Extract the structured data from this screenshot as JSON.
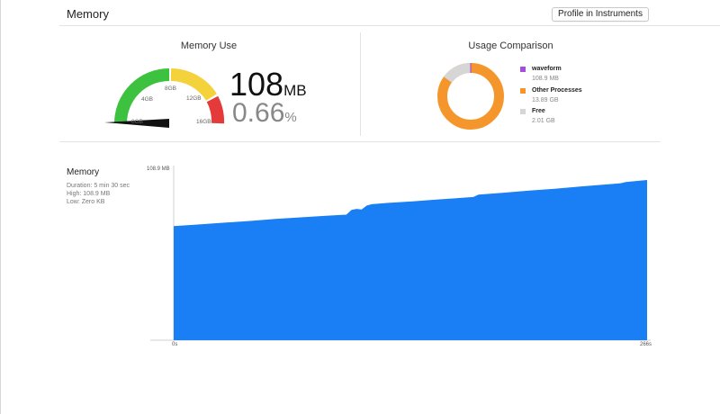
{
  "header": {
    "title": "Memory",
    "profile_button": "Profile in Instruments"
  },
  "memory_use": {
    "title": "Memory Use",
    "value": "108",
    "unit": "MB",
    "percent": "0.66",
    "percent_symbol": "%",
    "gauge_labels": [
      "0GB",
      "4GB",
      "8GB",
      "12GB",
      "16GB"
    ],
    "gauge_fraction": 0.0066,
    "colors": {
      "green": "#3cc23f",
      "yellow": "#f4d23b",
      "red": "#e43a3a",
      "needle": "#111111"
    }
  },
  "usage_comparison": {
    "title": "Usage Comparison",
    "legend": [
      {
        "name": "waveform",
        "value": "108.9 MB",
        "color": "#a64fd6"
      },
      {
        "name": "Other Processes",
        "value": "13.89 GB",
        "color": "#f5962c"
      },
      {
        "name": "Free",
        "value": "2.01 GB",
        "color": "#d6d6d6"
      }
    ]
  },
  "memory_graph": {
    "title": "Memory",
    "duration": "Duration: 5 min 30 sec",
    "high": "High: 108.9 MB",
    "low": "Low: Zero KB",
    "color": "#1a7ef5"
  },
  "chart_data": {
    "type": "area",
    "x_start_label": "0s",
    "x_end_label": "266s",
    "y_max_label": "108.9 MB",
    "ylim": [
      0,
      108.9
    ],
    "xlim": [
      0,
      266
    ],
    "x": [
      0,
      25,
      50,
      75,
      100,
      125,
      150,
      170,
      175,
      180,
      185,
      190,
      195,
      210,
      235,
      260,
      275,
      295,
      300,
      325,
      350,
      375,
      400,
      425,
      440,
      445,
      460,
      466
    ],
    "values": [
      71.1,
      72.2,
      73.3,
      74.4,
      75.6,
      76.6,
      77.6,
      78.3,
      81.2,
      81.9,
      81.5,
      84.0,
      84.8,
      85.6,
      86.6,
      87.8,
      88.4,
      89.3,
      90.8,
      92.0,
      93.3,
      94.5,
      95.8,
      97.1,
      97.9,
      98.7,
      99.6,
      99.9
    ],
    "grid": false
  }
}
